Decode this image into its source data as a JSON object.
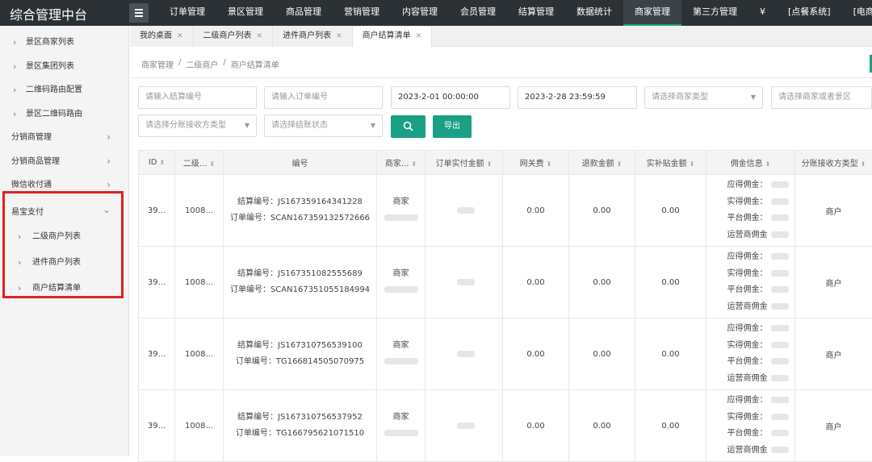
{
  "app": {
    "title": "综合管理中台"
  },
  "nav": {
    "items": [
      "订单管理",
      "景区管理",
      "商品管理",
      "营销管理",
      "内容管理",
      "会员管理",
      "结算管理",
      "数据统计",
      "商家管理",
      "第三方管理",
      "¥",
      "[点餐系统]",
      "[电商系统]"
    ],
    "active_index": 8
  },
  "sidebar": {
    "items": [
      {
        "label": "景区商家列表",
        "level": "sub"
      },
      {
        "label": "景区集团列表",
        "level": "sub"
      },
      {
        "label": "二维码路由配置",
        "level": "sub"
      },
      {
        "label": "景区二维码路由",
        "level": "sub"
      },
      {
        "label": "分销商管理",
        "level": "top"
      },
      {
        "label": "分销商品管理",
        "level": "top"
      },
      {
        "label": "微信收付通",
        "level": "top"
      },
      {
        "label": "易宝支付",
        "level": "top-open"
      },
      {
        "label": "二级商户列表",
        "level": "sub2"
      },
      {
        "label": "进件商户列表",
        "level": "sub2"
      },
      {
        "label": "商户结算清单",
        "level": "sub2"
      }
    ]
  },
  "tabs": [
    {
      "label": "我的桌面"
    },
    {
      "label": "二级商户列表"
    },
    {
      "label": "进件商户列表"
    },
    {
      "label": "商户结算清单",
      "active": true
    }
  ],
  "breadcrumb": {
    "items": [
      "商家管理",
      "/",
      "二级商户",
      "/",
      "商户结算清单"
    ]
  },
  "filters": {
    "settle_no_placeholder": "请输入结算编号",
    "order_no_placeholder": "请输入订单编号",
    "start_date": "2023-2-01 00:00:00",
    "end_date": "2023-2-28 23:59:59",
    "merchant_type_placeholder": "请选择商家类型",
    "merchant_or_scenic_placeholder": "请选择商家或者景区",
    "split_type_placeholder": "请选择分账接收方类型",
    "status_placeholder": "请选择结账状态",
    "export_label": "导出"
  },
  "table": {
    "columns": [
      "ID",
      "二级...",
      "编号",
      "商家...",
      "订单实付金额",
      "网关费",
      "退款金额",
      "实补贴金额",
      "佣金信息",
      "分账接收方类型"
    ],
    "labels": {
      "settle": "结算编号：",
      "order": "订单编号：",
      "merchant": "商家",
      "due": "应得佣金：",
      "actual": "实得佣金：",
      "platform": "平台佣金：",
      "operator": "运营商佣金"
    },
    "rows": [
      {
        "id": "39...",
        "secondary": "1008...",
        "settle_no": "JS167359164341228",
        "order_no": "SCAN167359132572666",
        "gateway": "0.00",
        "refund": "0.00",
        "subsidy": "0.00",
        "receiver": "商户"
      },
      {
        "id": "39...",
        "secondary": "1008...",
        "settle_no": "JS167351082555689",
        "order_no": "SCAN167351055184994",
        "gateway": "0.00",
        "refund": "0.00",
        "subsidy": "0.00",
        "receiver": "商户"
      },
      {
        "id": "39...",
        "secondary": "1008...",
        "settle_no": "JS167310756539100",
        "order_no": "TG166814505070975",
        "gateway": "0.00",
        "refund": "0.00",
        "subsidy": "0.00",
        "receiver": "商户"
      },
      {
        "id": "39...",
        "secondary": "1008...",
        "settle_no": "JS167310756537952",
        "order_no": "TG166795621071510",
        "gateway": "0.00",
        "refund": "0.00",
        "subsidy": "0.00",
        "receiver": "商户"
      }
    ]
  },
  "colors": {
    "accent": "#1aa084",
    "topbar": "#2b3135",
    "highlight": "#e02020"
  }
}
